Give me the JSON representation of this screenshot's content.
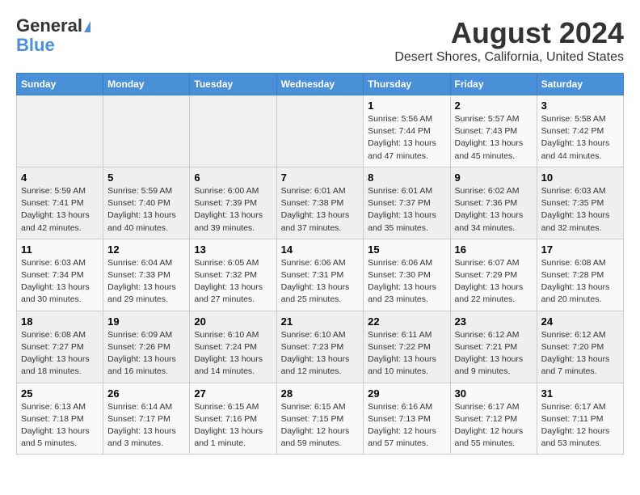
{
  "header": {
    "logo_general": "General",
    "logo_blue": "Blue",
    "title": "August 2024",
    "subtitle": "Desert Shores, California, United States"
  },
  "days_of_week": [
    "Sunday",
    "Monday",
    "Tuesday",
    "Wednesday",
    "Thursday",
    "Friday",
    "Saturday"
  ],
  "weeks": [
    [
      {
        "day": "",
        "info": ""
      },
      {
        "day": "",
        "info": ""
      },
      {
        "day": "",
        "info": ""
      },
      {
        "day": "",
        "info": ""
      },
      {
        "day": "1",
        "info": "Sunrise: 5:56 AM\nSunset: 7:44 PM\nDaylight: 13 hours\nand 47 minutes."
      },
      {
        "day": "2",
        "info": "Sunrise: 5:57 AM\nSunset: 7:43 PM\nDaylight: 13 hours\nand 45 minutes."
      },
      {
        "day": "3",
        "info": "Sunrise: 5:58 AM\nSunset: 7:42 PM\nDaylight: 13 hours\nand 44 minutes."
      }
    ],
    [
      {
        "day": "4",
        "info": "Sunrise: 5:59 AM\nSunset: 7:41 PM\nDaylight: 13 hours\nand 42 minutes."
      },
      {
        "day": "5",
        "info": "Sunrise: 5:59 AM\nSunset: 7:40 PM\nDaylight: 13 hours\nand 40 minutes."
      },
      {
        "day": "6",
        "info": "Sunrise: 6:00 AM\nSunset: 7:39 PM\nDaylight: 13 hours\nand 39 minutes."
      },
      {
        "day": "7",
        "info": "Sunrise: 6:01 AM\nSunset: 7:38 PM\nDaylight: 13 hours\nand 37 minutes."
      },
      {
        "day": "8",
        "info": "Sunrise: 6:01 AM\nSunset: 7:37 PM\nDaylight: 13 hours\nand 35 minutes."
      },
      {
        "day": "9",
        "info": "Sunrise: 6:02 AM\nSunset: 7:36 PM\nDaylight: 13 hours\nand 34 minutes."
      },
      {
        "day": "10",
        "info": "Sunrise: 6:03 AM\nSunset: 7:35 PM\nDaylight: 13 hours\nand 32 minutes."
      }
    ],
    [
      {
        "day": "11",
        "info": "Sunrise: 6:03 AM\nSunset: 7:34 PM\nDaylight: 13 hours\nand 30 minutes."
      },
      {
        "day": "12",
        "info": "Sunrise: 6:04 AM\nSunset: 7:33 PM\nDaylight: 13 hours\nand 29 minutes."
      },
      {
        "day": "13",
        "info": "Sunrise: 6:05 AM\nSunset: 7:32 PM\nDaylight: 13 hours\nand 27 minutes."
      },
      {
        "day": "14",
        "info": "Sunrise: 6:06 AM\nSunset: 7:31 PM\nDaylight: 13 hours\nand 25 minutes."
      },
      {
        "day": "15",
        "info": "Sunrise: 6:06 AM\nSunset: 7:30 PM\nDaylight: 13 hours\nand 23 minutes."
      },
      {
        "day": "16",
        "info": "Sunrise: 6:07 AM\nSunset: 7:29 PM\nDaylight: 13 hours\nand 22 minutes."
      },
      {
        "day": "17",
        "info": "Sunrise: 6:08 AM\nSunset: 7:28 PM\nDaylight: 13 hours\nand 20 minutes."
      }
    ],
    [
      {
        "day": "18",
        "info": "Sunrise: 6:08 AM\nSunset: 7:27 PM\nDaylight: 13 hours\nand 18 minutes."
      },
      {
        "day": "19",
        "info": "Sunrise: 6:09 AM\nSunset: 7:26 PM\nDaylight: 13 hours\nand 16 minutes."
      },
      {
        "day": "20",
        "info": "Sunrise: 6:10 AM\nSunset: 7:24 PM\nDaylight: 13 hours\nand 14 minutes."
      },
      {
        "day": "21",
        "info": "Sunrise: 6:10 AM\nSunset: 7:23 PM\nDaylight: 13 hours\nand 12 minutes."
      },
      {
        "day": "22",
        "info": "Sunrise: 6:11 AM\nSunset: 7:22 PM\nDaylight: 13 hours\nand 10 minutes."
      },
      {
        "day": "23",
        "info": "Sunrise: 6:12 AM\nSunset: 7:21 PM\nDaylight: 13 hours\nand 9 minutes."
      },
      {
        "day": "24",
        "info": "Sunrise: 6:12 AM\nSunset: 7:20 PM\nDaylight: 13 hours\nand 7 minutes."
      }
    ],
    [
      {
        "day": "25",
        "info": "Sunrise: 6:13 AM\nSunset: 7:18 PM\nDaylight: 13 hours\nand 5 minutes."
      },
      {
        "day": "26",
        "info": "Sunrise: 6:14 AM\nSunset: 7:17 PM\nDaylight: 13 hours\nand 3 minutes."
      },
      {
        "day": "27",
        "info": "Sunrise: 6:15 AM\nSunset: 7:16 PM\nDaylight: 13 hours\nand 1 minute."
      },
      {
        "day": "28",
        "info": "Sunrise: 6:15 AM\nSunset: 7:15 PM\nDaylight: 12 hours\nand 59 minutes."
      },
      {
        "day": "29",
        "info": "Sunrise: 6:16 AM\nSunset: 7:13 PM\nDaylight: 12 hours\nand 57 minutes."
      },
      {
        "day": "30",
        "info": "Sunrise: 6:17 AM\nSunset: 7:12 PM\nDaylight: 12 hours\nand 55 minutes."
      },
      {
        "day": "31",
        "info": "Sunrise: 6:17 AM\nSunset: 7:11 PM\nDaylight: 12 hours\nand 53 minutes."
      }
    ]
  ]
}
